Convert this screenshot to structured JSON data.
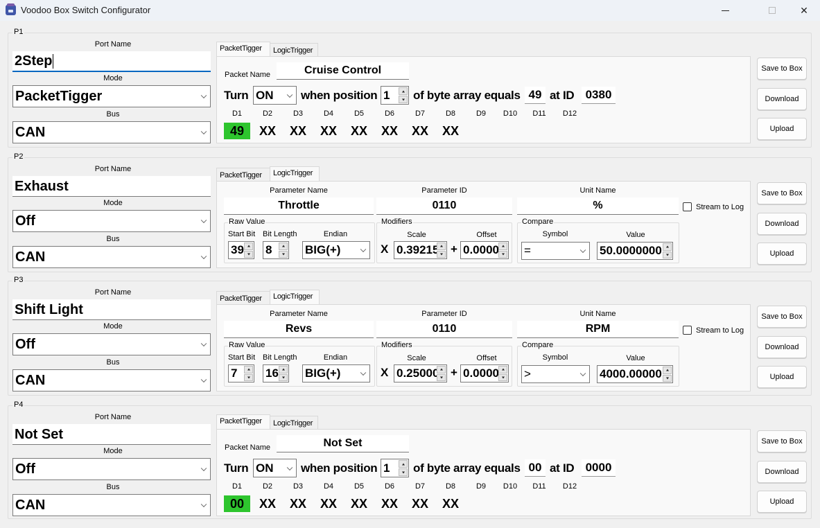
{
  "window": {
    "title": "Voodoo Box Switch Configurator",
    "icon": "voodoo-box-app-icon",
    "controls": {
      "minimize": "minimize-icon",
      "maximize": "maximize-icon",
      "close": "close-icon"
    }
  },
  "labels": {
    "port_name": "Port Name",
    "mode": "Mode",
    "bus": "Bus",
    "packet_name": "Packet Name",
    "parameter_name": "Parameter Name",
    "parameter_id": "Parameter ID",
    "unit_name": "Unit Name",
    "stream_to_log": "Stream to Log",
    "raw_value": "Raw Value",
    "start_bit": "Start Bit",
    "bit_length": "Bit Length",
    "endian": "Endian",
    "modifiers": "Modifiers",
    "scale": "Scale",
    "offset": "Offset",
    "compare": "Compare",
    "symbol": "Symbol",
    "value": "Value",
    "turn": "Turn",
    "when_position": "when position",
    "of_byte_array_equals": "of byte array equals",
    "at_id": "at ID",
    "multiply": "X",
    "plus": "+",
    "save_to_box": "Save to Box",
    "download": "Download",
    "upload": "Upload"
  },
  "tab_labels": {
    "packet": "PacketTigger",
    "logic": "LogicTrigger"
  },
  "data_headers": [
    "D1",
    "D2",
    "D3",
    "D4",
    "D5",
    "D6",
    "D7",
    "D8",
    "D9",
    "D10",
    "D11",
    "D12"
  ],
  "ports": [
    {
      "group": "P1",
      "port_name": "2Step",
      "mode": "PacketTigger",
      "bus": "CAN",
      "active_tab": "packet",
      "packet": {
        "packet_name": "Cruise Control",
        "turn": "ON",
        "position": "1",
        "equals": "49",
        "id": "0380",
        "bytes": [
          "49",
          "XX",
          "XX",
          "XX",
          "XX",
          "XX",
          "XX",
          "XX"
        ],
        "highlight_index": 0,
        "highlight_color": "#2ec52e"
      }
    },
    {
      "group": "P2",
      "port_name": "Exhaust",
      "mode": "Off",
      "bus": "CAN",
      "active_tab": "logic",
      "logic": {
        "parameter_name": "Throttle",
        "parameter_id": "0110",
        "unit_name": "%",
        "stream_to_log": false,
        "start_bit": "39",
        "bit_length": "8",
        "endian": "BIG(+)",
        "scale": "0.39215",
        "offset": "0.0000",
        "symbol": "=",
        "value": "50.0000000"
      }
    },
    {
      "group": "P3",
      "port_name": "Shift Light",
      "mode": "Off",
      "bus": "CAN",
      "active_tab": "logic",
      "logic": {
        "parameter_name": "Revs",
        "parameter_id": "0110",
        "unit_name": "RPM",
        "stream_to_log": false,
        "start_bit": "7",
        "bit_length": "16",
        "endian": "BIG(+)",
        "scale": "0.25000",
        "offset": "0.0000",
        "symbol": ">",
        "value": "4000.00000"
      }
    },
    {
      "group": "P4",
      "port_name": "Not Set",
      "mode": "Off",
      "bus": "CAN",
      "active_tab": "packet",
      "packet": {
        "packet_name": "Not Set",
        "turn": "ON",
        "position": "1",
        "equals": "00",
        "id": "0000",
        "bytes": [
          "00",
          "XX",
          "XX",
          "XX",
          "XX",
          "XX",
          "XX",
          "XX"
        ],
        "highlight_index": 0,
        "highlight_color": "#2ec52e"
      }
    }
  ]
}
